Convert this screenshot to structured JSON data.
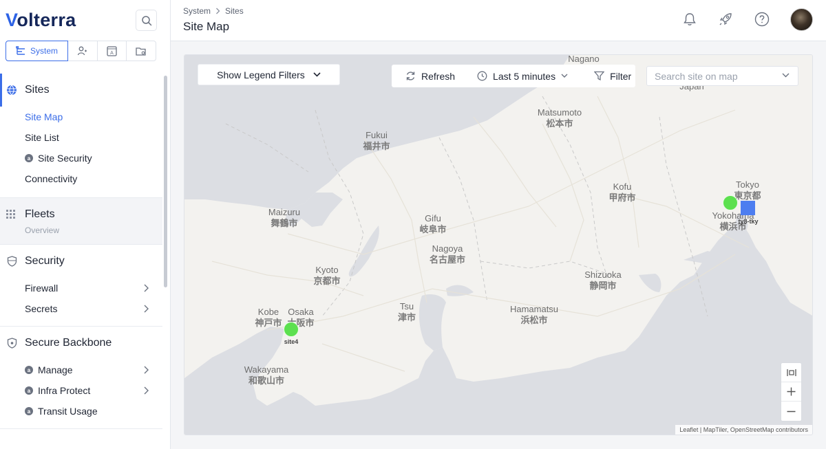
{
  "brand": {
    "name_v": "V",
    "name_rest": "olterra"
  },
  "workspace_tabs": [
    {
      "label": "System",
      "icon": "tree-icon",
      "active": true
    },
    {
      "label": "",
      "icon": "users-icon"
    },
    {
      "label": "",
      "icon": "app-icon"
    },
    {
      "label": "",
      "icon": "folder-gear-icon"
    }
  ],
  "nav": {
    "sites": {
      "title": "Sites",
      "items": [
        "Site Map",
        "Site List",
        "Site Security",
        "Connectivity"
      ]
    },
    "fleets": {
      "title": "Fleets",
      "subtitle": "Overview"
    },
    "security": {
      "title": "Security",
      "items": [
        "Firewall",
        "Secrets"
      ]
    },
    "backbone": {
      "title": "Secure Backbone",
      "items": [
        "Manage",
        "Infra Protect",
        "Transit Usage"
      ]
    }
  },
  "header": {
    "breadcrumb": [
      "System",
      "Sites"
    ],
    "title": "Site Map"
  },
  "map_controls": {
    "legend_label": "Show Legend Filters",
    "refresh_label": "Refresh",
    "time_label": "Last 5 minutes",
    "filter_label": "Filter",
    "search_placeholder": "Search site on map",
    "attribution": "Leaflet | MapTiler, OpenStreetMap contributors"
  },
  "map_labels": [
    {
      "en": "Nagano",
      "jp": ""
    },
    {
      "en": "Japan",
      "jp": ""
    },
    {
      "en": "Matsumoto",
      "jp": "松本市"
    },
    {
      "en": "Fukui",
      "jp": "福井市"
    },
    {
      "en": "Kofu",
      "jp": "甲府市"
    },
    {
      "en": "Tokyo",
      "jp": "東京都"
    },
    {
      "en": "Yokohama",
      "jp": "横浜市"
    },
    {
      "en": "Maizuru",
      "jp": "舞鶴市"
    },
    {
      "en": "Gifu",
      "jp": "岐阜市"
    },
    {
      "en": "Nagoya",
      "jp": "名古屋市"
    },
    {
      "en": "Kyoto",
      "jp": "京都市"
    },
    {
      "en": "Shizuoka",
      "jp": "静岡市"
    },
    {
      "en": "Kobe",
      "jp": "神戸市"
    },
    {
      "en": "Osaka",
      "jp": "大阪市"
    },
    {
      "en": "Tsu",
      "jp": "津市"
    },
    {
      "en": "Hamamatsu",
      "jp": "浜松市"
    },
    {
      "en": "Wakayama",
      "jp": "和歌山市"
    }
  ],
  "sites": [
    {
      "name": "site4",
      "status": "healthy",
      "color": "#5ce04f"
    },
    {
      "name": "",
      "status": "healthy",
      "color": "#5ce04f"
    },
    {
      "name": "ty8-tky",
      "status": "regional-edge",
      "color": "#4d7ef0"
    }
  ],
  "colors": {
    "accent": "#3c6ee8",
    "water": "#dcdee3",
    "land": "#f3f2ef"
  }
}
